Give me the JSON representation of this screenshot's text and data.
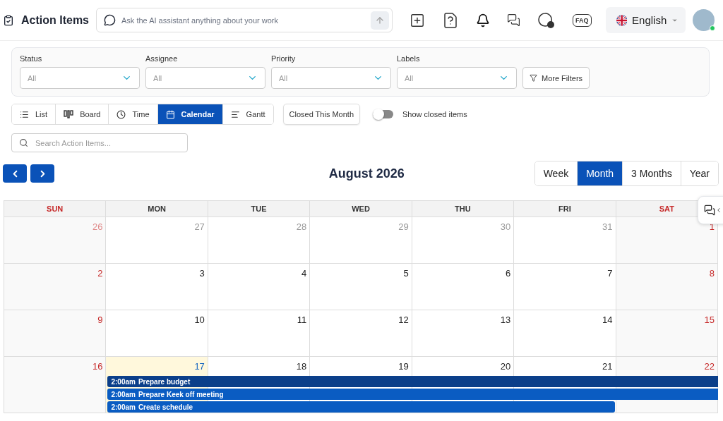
{
  "header": {
    "title": "Action Items",
    "ai_placeholder": "Ask the AI assistant anything about your work",
    "faq": "FAQ",
    "language": "English",
    "user_online": true
  },
  "filters": [
    {
      "label": "Status",
      "value": "All"
    },
    {
      "label": "Assignee",
      "value": "All"
    },
    {
      "label": "Priority",
      "value": "All"
    },
    {
      "label": "Labels",
      "value": "All"
    }
  ],
  "more_filters": "More Filters",
  "views": [
    {
      "kind": "list",
      "label": "List",
      "selected": false
    },
    {
      "kind": "board",
      "label": "Board",
      "selected": false
    },
    {
      "kind": "time",
      "label": "Time",
      "selected": false
    },
    {
      "kind": "calendar",
      "label": "Calendar",
      "selected": true
    },
    {
      "kind": "gantt",
      "label": "Gantt",
      "selected": false
    }
  ],
  "closed_this_month": "Closed This Month",
  "show_closed": {
    "label": "Show closed items",
    "on": false
  },
  "search": {
    "placeholder": "Search Action Items..."
  },
  "calendar": {
    "title": "August 2026",
    "ranges": [
      {
        "label": "Week",
        "selected": false
      },
      {
        "label": "Month",
        "selected": true
      },
      {
        "label": "3 Months",
        "selected": false
      },
      {
        "label": "Year",
        "selected": false
      }
    ],
    "weekdays": [
      {
        "label": "SUN",
        "weekend": true
      },
      {
        "label": "MON",
        "weekend": false
      },
      {
        "label": "TUE",
        "weekend": false
      },
      {
        "label": "WED",
        "weekend": false
      },
      {
        "label": "THU",
        "weekend": false
      },
      {
        "label": "FRI",
        "weekend": false
      },
      {
        "label": "SAT",
        "weekend": true
      }
    ],
    "weeks": [
      {
        "days": [
          {
            "label": "26",
            "muted": true,
            "today": false
          },
          {
            "label": "27",
            "muted": true,
            "today": false
          },
          {
            "label": "28",
            "muted": true,
            "today": false
          },
          {
            "label": "29",
            "muted": true,
            "today": false
          },
          {
            "label": "30",
            "muted": true,
            "today": false
          },
          {
            "label": "31",
            "muted": true,
            "today": false
          },
          {
            "label": "1",
            "muted": false,
            "today": false
          }
        ]
      },
      {
        "days": [
          {
            "label": "2",
            "muted": false,
            "today": false
          },
          {
            "label": "3",
            "muted": false,
            "today": false
          },
          {
            "label": "4",
            "muted": false,
            "today": false
          },
          {
            "label": "5",
            "muted": false,
            "today": false
          },
          {
            "label": "6",
            "muted": false,
            "today": false
          },
          {
            "label": "7",
            "muted": false,
            "today": false
          },
          {
            "label": "8",
            "muted": false,
            "today": false
          }
        ]
      },
      {
        "days": [
          {
            "label": "9",
            "muted": false,
            "today": false
          },
          {
            "label": "10",
            "muted": false,
            "today": false
          },
          {
            "label": "11",
            "muted": false,
            "today": false
          },
          {
            "label": "12",
            "muted": false,
            "today": false
          },
          {
            "label": "13",
            "muted": false,
            "today": false
          },
          {
            "label": "14",
            "muted": false,
            "today": false
          },
          {
            "label": "15",
            "muted": false,
            "today": false
          }
        ]
      },
      {
        "days": [
          {
            "label": "16",
            "muted": false,
            "today": false
          },
          {
            "label": "17",
            "muted": false,
            "today": true,
            "events": [
              {
                "time": "2:00am",
                "title": "Prepare budget",
                "selected": true,
                "continues": true
              },
              {
                "time": "2:00am",
                "title": "Prepare Keek off meeting",
                "selected": false,
                "continues": true
              },
              {
                "time": "2:00am",
                "title": "Create schedule",
                "selected": false,
                "continues": false
              }
            ]
          },
          {
            "label": "18",
            "muted": false,
            "today": false
          },
          {
            "label": "19",
            "muted": false,
            "today": false
          },
          {
            "label": "20",
            "muted": false,
            "today": false
          },
          {
            "label": "21",
            "muted": false,
            "today": false
          },
          {
            "label": "22",
            "muted": false,
            "today": false
          }
        ]
      }
    ]
  }
}
